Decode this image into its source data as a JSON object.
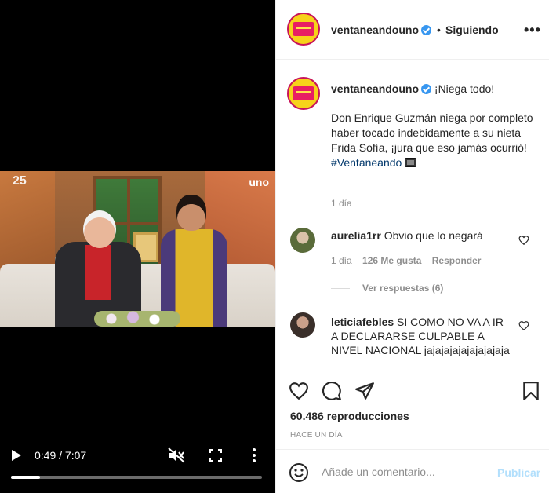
{
  "video": {
    "watermark_left": "25",
    "watermark_right": "uno",
    "time": "0:49 / 7:07",
    "progress": 0.115,
    "icons": {
      "play": "play-icon",
      "mute": "volume-muted-icon",
      "fullscreen": "fullscreen-icon",
      "more": "more-vertical-icon"
    }
  },
  "header": {
    "username": "ventaneandouno",
    "separator": "•",
    "following_label": "Siguiendo",
    "more_label": "•••"
  },
  "caption": {
    "username": "ventaneandouno",
    "headline": "¡Niega todo!",
    "body": "Don Enrique Guzmán niega por completo haber tocado indebidamente a su nieta Frida Sofía, ¡jura que eso jamás ocurrió!",
    "hashtag": "#Ventaneando",
    "age": "1 día"
  },
  "comments": [
    {
      "username": "aurelia1rr",
      "text": "Obvio que lo negará",
      "age": "1 día",
      "likes": "126 Me gusta",
      "reply_label": "Responder",
      "view_replies": "Ver respuestas (6)"
    },
    {
      "username": "leticiafebles",
      "text": "SI COMO NO VA A IR A DECLARARSE CULPABLE A NIVEL NACIONAL jajajajajajajajajaja"
    }
  ],
  "actions": {
    "views": "60.486 reproducciones",
    "time_ago": "HACE UN DÍA"
  },
  "comment_box": {
    "placeholder": "Añade un comentario...",
    "publish_label": "Publicar"
  },
  "colors": {
    "verified": "#3897f0",
    "publish_disabled": "#b2dffc",
    "hashtag": "#00376b",
    "muted_text": "#8e8e8e"
  }
}
